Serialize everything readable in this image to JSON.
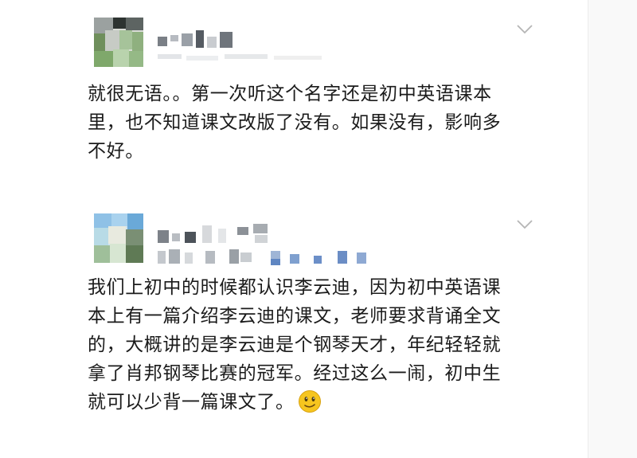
{
  "posts": [
    {
      "author_name": "",
      "author_meta": "",
      "body": "就很无语。。第一次听这个名字还是初中英语课本\n里，也不知道课文改版了没有。如果没有，影响多\n不好。",
      "menu_icon": "chevron-down-icon",
      "avatar_icon": "avatar-pixelated"
    },
    {
      "author_name": "",
      "author_meta": "",
      "body": "我们上初中的时候都认识李云迪，因为初中英语课\n本上有一篇介绍李云迪的课文，老师要求背诵全文\n的，大概讲的是李云迪是个钢琴天才，年纪轻轻就\n拿了肖邦钢琴比赛的冠军。经过这么一闹，初中生\n就可以少背一篇课文了。",
      "trailing_emoji": "thinking-smile-emoji",
      "menu_icon": "chevron-down-icon",
      "avatar_icon": "avatar-pixelated"
    }
  ],
  "colors": {
    "text": "#1b1b1b",
    "chevron": "#b5b5b5",
    "emoji_face": "#f6c51f"
  }
}
